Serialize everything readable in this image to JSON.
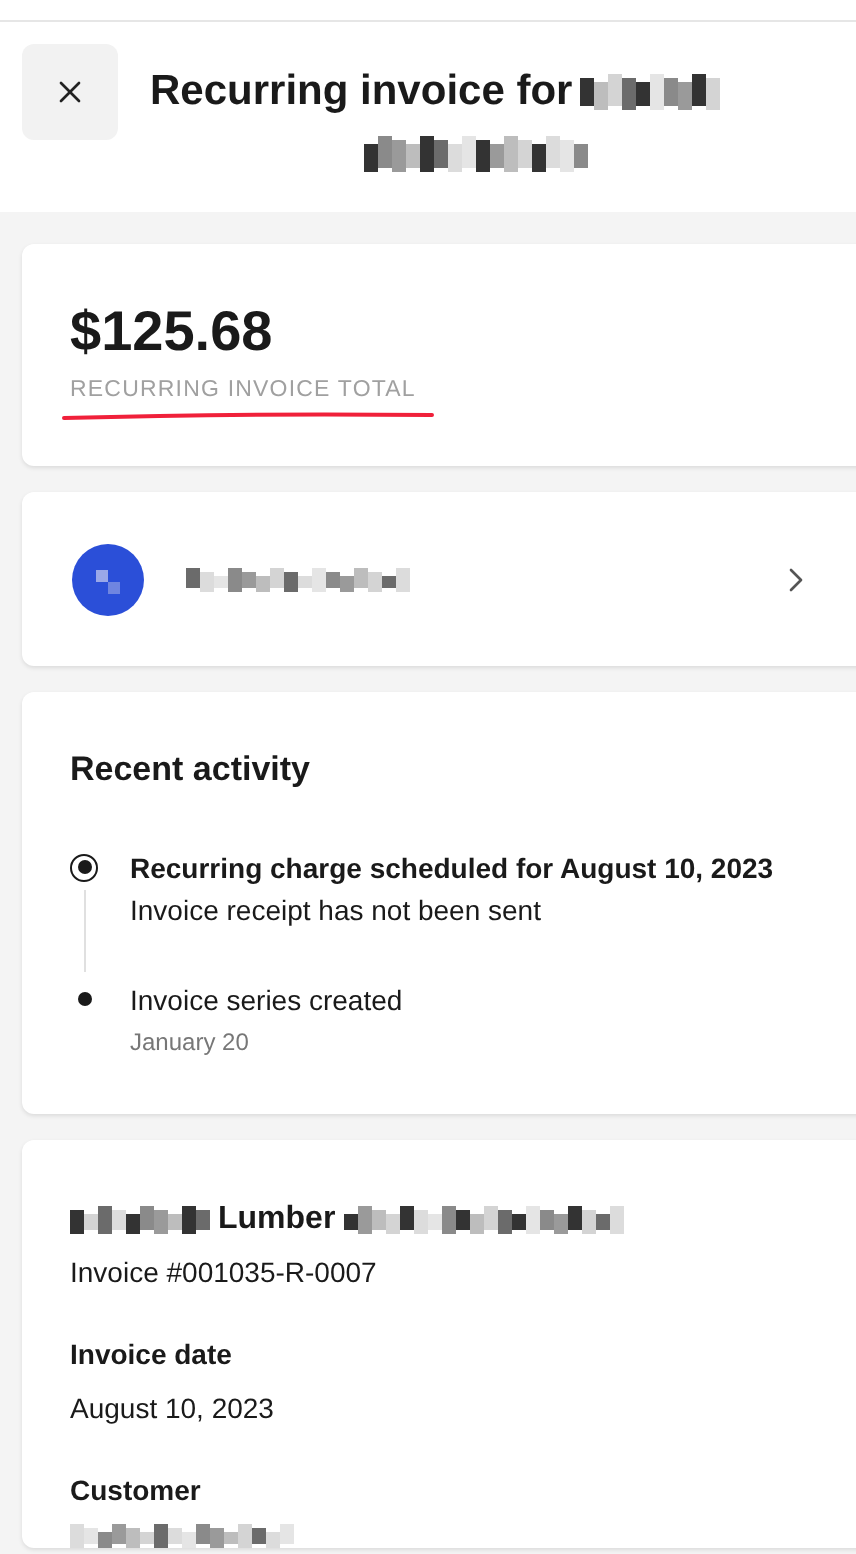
{
  "header": {
    "title": "Recurring invoice for"
  },
  "total": {
    "amount": "$125.68",
    "label": "RECURRING INVOICE TOTAL"
  },
  "activity": {
    "title": "Recent activity",
    "events": [
      {
        "kind": "current",
        "title": "Recurring charge scheduled for August 10, 2023",
        "detail": "Invoice receipt has not been sent"
      },
      {
        "kind": "past",
        "title": "Invoice series created",
        "detail": "January 20"
      }
    ]
  },
  "invoice": {
    "business_name_part": "Lumber",
    "number": "Invoice #001035-R-0007",
    "fields": [
      {
        "label": "Invoice date",
        "value": "August 10, 2023"
      },
      {
        "label": "Customer"
      }
    ]
  }
}
